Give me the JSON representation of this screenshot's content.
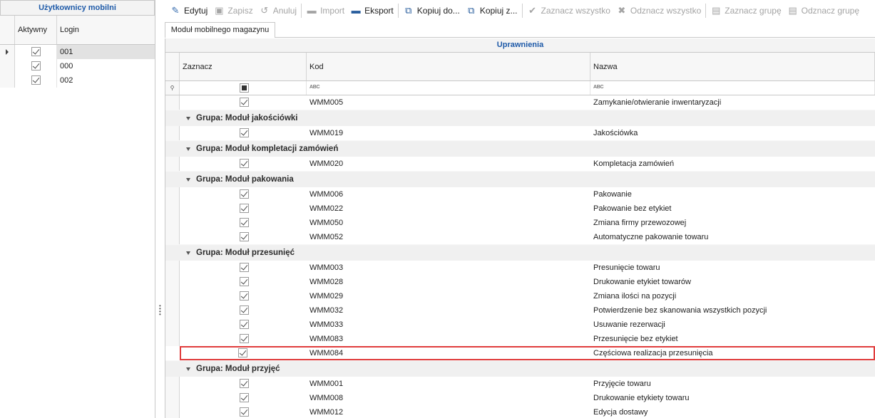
{
  "left_panel": {
    "title": "Użytkownicy mobilni",
    "columns": [
      "Aktywny",
      "Login"
    ],
    "rows": [
      {
        "active": true,
        "login": "001",
        "selected": true
      },
      {
        "active": true,
        "login": "000",
        "selected": false
      },
      {
        "active": true,
        "login": "002",
        "selected": false
      }
    ]
  },
  "toolbar": {
    "edit": "Edytuj",
    "save": "Zapisz",
    "cancel": "Anuluj",
    "import": "Import",
    "export": "Eksport",
    "copy_to": "Kopiuj do...",
    "copy_from": "Kopiuj z...",
    "select_all": "Zaznacz wszystko",
    "deselect_all": "Odznacz wszystko",
    "select_group": "Zaznacz grupę",
    "deselect_group": "Odznacz grupę"
  },
  "tab": {
    "label": "Moduł mobilnego magazynu"
  },
  "grid": {
    "title": "Uprawnienia",
    "columns": {
      "select": "Zaznacz",
      "code": "Kod",
      "name": "Nazwa"
    },
    "filter_text_icon": "ABC",
    "top_rows": [
      {
        "code": "WMM005",
        "name": "Zamykanie/otwieranie inwentaryzacji"
      }
    ],
    "groups": [
      {
        "label": "Grupa: Moduł jakościówki",
        "rows": [
          {
            "code": "WMM019",
            "name": "Jakościówka"
          }
        ]
      },
      {
        "label": "Grupa: Moduł kompletacji zamówień",
        "rows": [
          {
            "code": "WMM020",
            "name": "Kompletacja zamówień"
          }
        ]
      },
      {
        "label": "Grupa: Moduł pakowania",
        "rows": [
          {
            "code": "WMM006",
            "name": "Pakowanie"
          },
          {
            "code": "WMM022",
            "name": "Pakowanie bez etykiet"
          },
          {
            "code": "WMM050",
            "name": "Zmiana firmy przewozowej"
          },
          {
            "code": "WMM052",
            "name": "Automatyczne pakowanie towaru"
          }
        ]
      },
      {
        "label": "Grupa: Moduł przesunięć",
        "rows": [
          {
            "code": "WMM003",
            "name": "Presunięcie towaru"
          },
          {
            "code": "WMM028",
            "name": "Drukowanie etykiet towarów"
          },
          {
            "code": "WMM029",
            "name": "Zmiana ilości na pozycji"
          },
          {
            "code": "WMM032",
            "name": "Potwierdzenie bez skanowania wszystkich pozycji"
          },
          {
            "code": "WMM033",
            "name": "Usuwanie rezerwacji"
          },
          {
            "code": "WMM083",
            "name": "Przesunięcie bez etykiet"
          },
          {
            "code": "WMM084",
            "name": "Częściowa realizacja przesunięcia"
          }
        ]
      },
      {
        "label": "Grupa: Moduł przyjęć",
        "rows": [
          {
            "code": "WMM001",
            "name": "Przyjęcie towaru"
          },
          {
            "code": "WMM008",
            "name": "Drukowanie etykiety towaru"
          },
          {
            "code": "WMM012",
            "name": "Edycja dostawy"
          }
        ]
      }
    ]
  },
  "colors": {
    "accent": "#1e5aa8",
    "highlight": "#e03c3c"
  }
}
